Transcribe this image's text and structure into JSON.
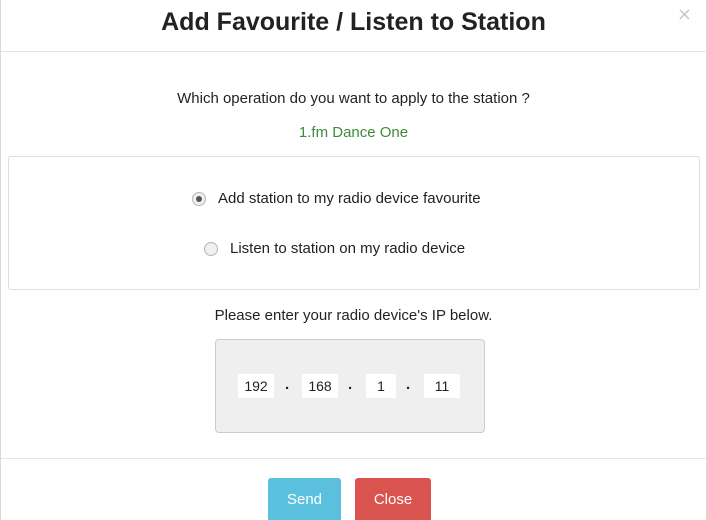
{
  "modal": {
    "title": "Add Favourite / Listen to Station",
    "close_icon": "×"
  },
  "question": "Which operation do you want to apply to the station ?",
  "station": {
    "name": "1.fm Dance One",
    "name_color": "#3c8b3c"
  },
  "options": [
    {
      "label": "Add station to my radio device favourite",
      "checked": true
    },
    {
      "label": "Listen to station on my radio device",
      "checked": false
    }
  ],
  "ip": {
    "label": "Please enter your radio device's IP below.",
    "octets": [
      "192",
      "168",
      "1",
      "11"
    ],
    "separator": "."
  },
  "buttons": {
    "send": {
      "label": "Send",
      "color": "#5bc0de"
    },
    "close": {
      "label": "Close",
      "color": "#d9534f"
    }
  }
}
